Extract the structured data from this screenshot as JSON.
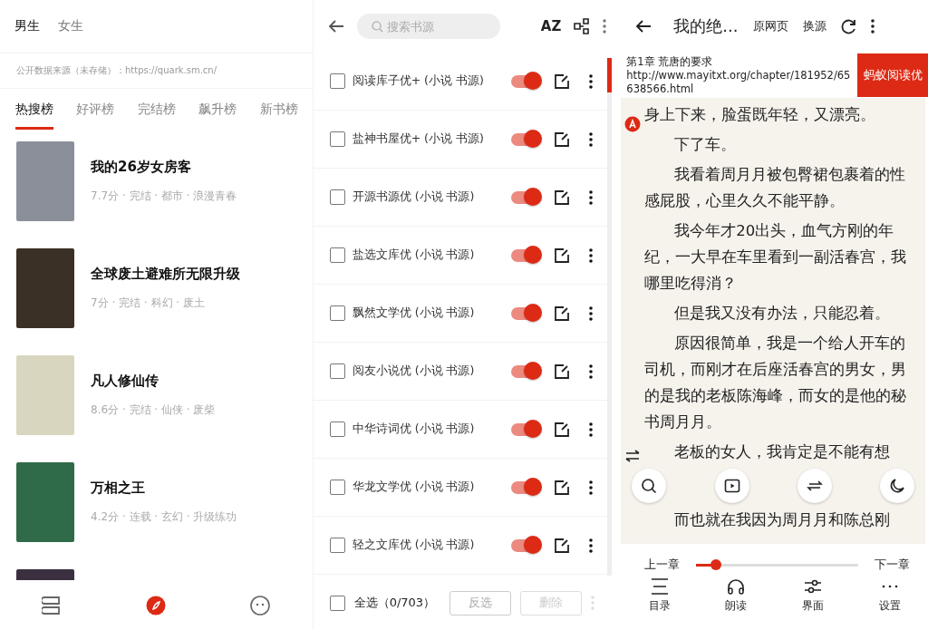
{
  "discover": {
    "gender_tabs": [
      {
        "label": "男生",
        "selected": true
      },
      {
        "label": "女生",
        "selected": false
      }
    ],
    "source_note": "公开数据来源（未存储）：https://quark.sm.cn/",
    "rank_tabs": [
      {
        "label": "热搜榜",
        "selected": true
      },
      {
        "label": "好评榜",
        "selected": false
      },
      {
        "label": "完结榜",
        "selected": false
      },
      {
        "label": "飙升榜",
        "selected": false
      },
      {
        "label": "新书榜",
        "selected": false
      }
    ],
    "books": [
      {
        "title": "我的26岁女房客",
        "meta": "7.7分 · 完结 · 都市 · 浪漫青春",
        "color": "#8a8f99"
      },
      {
        "title": "全球废土避难所无限升级",
        "meta": "7分 · 完结 · 科幻 · 废土",
        "color": "#3b3026"
      },
      {
        "title": "凡人修仙传",
        "meta": "8.6分 · 完结 · 仙侠 · 废柴",
        "color": "#d9d6bf"
      },
      {
        "title": "万相之王",
        "meta": "4.2分 · 连载 · 玄幻 · 升级练功",
        "color": "#2f6b48"
      }
    ],
    "nav": [
      {
        "kind": "shelf",
        "selected": false
      },
      {
        "kind": "discover",
        "selected": true
      },
      {
        "kind": "profile",
        "selected": false
      }
    ]
  },
  "sources": {
    "search": {
      "placeholder": "搜索书源"
    },
    "sort_label": "AZ",
    "rows": [
      {
        "name": "阅读库子优+ (小说 书源)",
        "checked": false,
        "on": true
      },
      {
        "name": "盐神书屋优+ (小说 书源)",
        "checked": false,
        "on": true
      },
      {
        "name": "开源书源优 (小说 书源)",
        "checked": false,
        "on": true
      },
      {
        "name": "盐选文库优 (小说 书源)",
        "checked": false,
        "on": true
      },
      {
        "name": "飘然文学优 (小说 书源)",
        "checked": false,
        "on": true
      },
      {
        "name": "阅友小说优 (小说 书源)",
        "checked": false,
        "on": true
      },
      {
        "name": "中华诗词优 (小说 书源)",
        "checked": false,
        "on": true
      },
      {
        "name": "华龙文学优 (小说 书源)",
        "checked": false,
        "on": true
      },
      {
        "name": "轻之文库优 (小说 书源)",
        "checked": false,
        "on": true
      }
    ],
    "select_all": {
      "label": "全选（0/703）",
      "checked": false
    },
    "buttons": [
      {
        "label": "反选",
        "disabled": false
      },
      {
        "label": "删除",
        "disabled": true
      }
    ]
  },
  "reader": {
    "title": "我的绝...",
    "actions": [
      "原网页",
      "换源"
    ],
    "chapter": "第1章 荒唐的要求",
    "url": "http://www.mayitxt.org/chapter/181952/65638566.html",
    "source_button": "蚂蚁阅读优",
    "paragraphs": [
      {
        "text": "身上下来，脸蛋既年轻，又漂亮。",
        "indent": false
      },
      {
        "text": "下了车。",
        "indent": true
      },
      {
        "text": "我看着周月月被包臀裙包裹着的性感屁股，心里久久不能平静。",
        "indent": true
      },
      {
        "text": "我今年才20出头，血气方刚的年纪，一大早在车里看到一副活春宫，我哪里吃得消？",
        "indent": true
      },
      {
        "text": "但是我又没有办法，只能忍着。",
        "indent": true
      },
      {
        "text": "原因很简单，我是一个给人开车的司机，而刚才在后座活春宫的男女，男的是我的老板陈海峰，而女的是他的秘书周月月。",
        "indent": true
      },
      {
        "text": "老板的女人，我肯定是不能有想",
        "indent": true
      }
    ],
    "last_line": "而也就在我因为周月月和陈总刚",
    "prev": "上一章",
    "next": "下一章",
    "progress": {
      "level": 0.12
    },
    "menu": [
      {
        "kind": "toc",
        "label": "目录"
      },
      {
        "kind": "listen",
        "label": "朗读"
      },
      {
        "kind": "layout",
        "label": "界面"
      },
      {
        "kind": "more",
        "label": "设置"
      }
    ]
  }
}
